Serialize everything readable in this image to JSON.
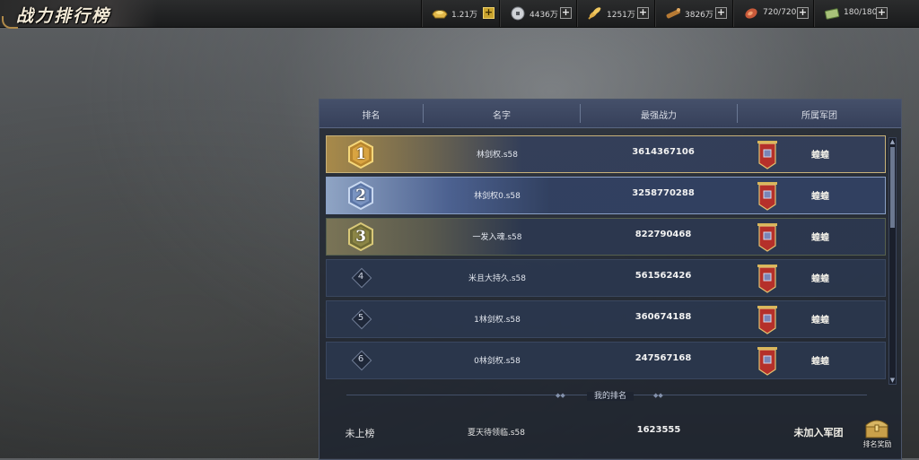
{
  "page_title": "战力排行榜",
  "resources": [
    {
      "icon": "gold-ingot-icon",
      "value": "1.21万",
      "plus_style": "gold"
    },
    {
      "icon": "silver-coin-icon",
      "value": "4436万",
      "plus_style": "plain"
    },
    {
      "icon": "grain-icon",
      "value": "1251万",
      "plus_style": "plain"
    },
    {
      "icon": "wood-icon",
      "value": "3826万",
      "plus_style": "plain"
    },
    {
      "icon": "meat-stamina-icon",
      "value": "720/720",
      "plus_style": "plain"
    },
    {
      "icon": "banknote-icon",
      "value": "180/180",
      "plus_style": "plain"
    }
  ],
  "table": {
    "headers": {
      "rank": "排名",
      "name": "名字",
      "power": "最强战力",
      "legion": "所属军团"
    },
    "rows": [
      {
        "rank": "1",
        "name": "林剑权.s58",
        "power": "3614367106",
        "legion": "蝗蝗",
        "style": "gold"
      },
      {
        "rank": "2",
        "name": "林剑权0.s58",
        "power": "3258770288",
        "legion": "蝗蝗",
        "style": "silver"
      },
      {
        "rank": "3",
        "name": "一发入魂.s58",
        "power": "822790468",
        "legion": "蝗蝗",
        "style": "bronze"
      },
      {
        "rank": "4",
        "name": "米且大持久.s58",
        "power": "561562426",
        "legion": "蝗蝗",
        "style": "normal"
      },
      {
        "rank": "5",
        "name": "1林剑权.s58",
        "power": "360674188",
        "legion": "蝗蝗",
        "style": "normal"
      },
      {
        "rank": "6",
        "name": "0林剑权.s58",
        "power": "247567168",
        "legion": "蝗蝗",
        "style": "normal"
      }
    ]
  },
  "my_rank": {
    "section_label": "我的排名",
    "rank": "未上榜",
    "name": "夏天待领临.s58",
    "power": "1623555",
    "legion": "未加入军团"
  },
  "reward_button": {
    "label": "排名奖励"
  },
  "colors": {
    "gold_accent": "#c9a32e",
    "banner_red": "#b5302a",
    "panel_bg": "#1e2430"
  }
}
